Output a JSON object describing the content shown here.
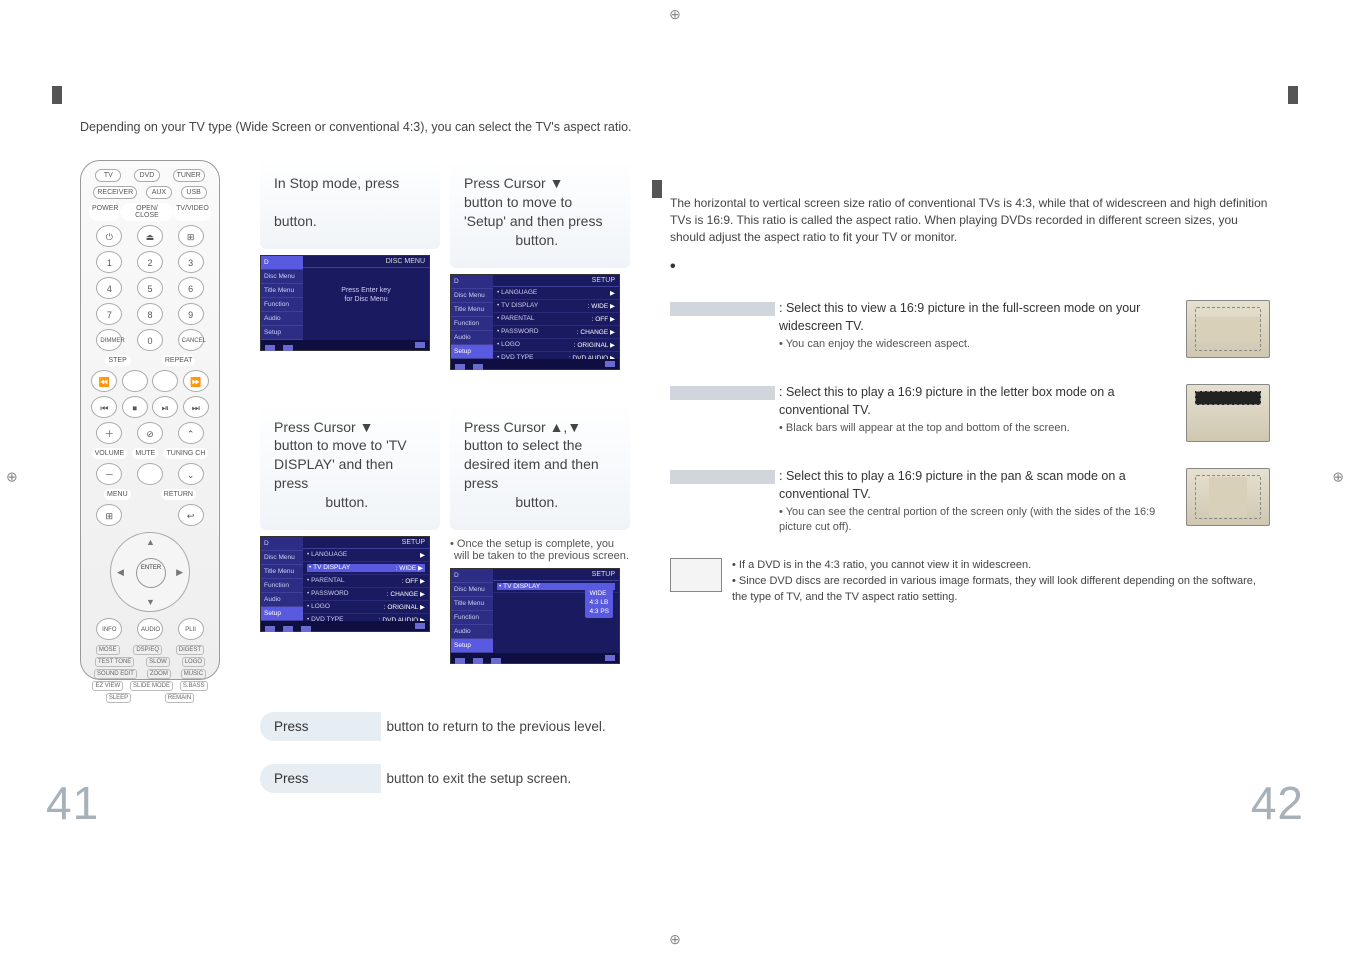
{
  "intro": "Depending on your TV type (Wide Screen  or conventional 4:3), you can select the TV's aspect ratio.",
  "remote": {
    "row1": [
      "TV",
      "DVD",
      "TUNER"
    ],
    "row2": [
      "RECEIVER",
      "AUX",
      "USB"
    ],
    "row3_labels": [
      "POWER",
      "OPEN/\nCLOSE",
      "TV/VIDEO"
    ],
    "digits": [
      "1",
      "2",
      "3",
      "4",
      "5",
      "6",
      "7",
      "8",
      "9",
      "0"
    ],
    "dimmer": "DIMMER",
    "cancel": "CANCEL",
    "step": "STEP",
    "repeat": "REPEAT",
    "mute": "MUTE",
    "volume": "VOLUME",
    "tuning": "TUNING CH",
    "menu": "MENU",
    "return": "RETURN",
    "enter": "ENTER",
    "info": "INFO",
    "audio": "AUDIO",
    "labels": [
      "MOSE",
      "DSP/EQ",
      "DIGEST",
      "TEST TONE",
      "SLOW",
      "LOGO",
      "SOUND EDIT",
      "ZOOM",
      "MUSIC",
      "EZ VIEW",
      "SLIDE MODE",
      "S.BASS",
      "SLEEP",
      "REMAIN"
    ]
  },
  "steps": {
    "s1": {
      "text_pre": "In Stop mode, press",
      "text_post": "button."
    },
    "s2": {
      "text_pre": "Press Cursor",
      "text_mid": "button to move to 'Setup' and then press",
      "text_post": "button."
    },
    "s3": {
      "text_pre": "Press Cursor",
      "text_mid": "button to move to 'TV DISPLAY' and then press",
      "text_post": "button."
    },
    "s4": {
      "text_pre": "Press Cursor",
      "text_mid": "button to select the desired item and then press",
      "text_post": "button."
    },
    "setup_note": "• Once the setup is complete, you will be taken to the previous screen."
  },
  "osd": {
    "side": [
      "Disc Menu",
      "Title Menu",
      "Function",
      "Audio",
      "Setup"
    ],
    "side_alt_top": "D",
    "menu_title": "DISC MENU",
    "setup_title": "SETUP",
    "disc_msg_line1": "Press Enter key",
    "disc_msg_line2": "for Disc Menu",
    "lines": [
      {
        "k": "LANGUAGE",
        "v": ""
      },
      {
        "k": "TV  DISPLAY",
        "v": "WIDE"
      },
      {
        "k": "PARENTAL",
        "v": "OFF"
      },
      {
        "k": "PASSWORD",
        "v": "CHANGE"
      },
      {
        "k": "LOGO",
        "v": "ORIGINAL"
      },
      {
        "k": "DVD TYPE",
        "v": "DVD AUDIO"
      }
    ],
    "tv_opts": [
      "WIDE",
      "4:3 LB",
      "4:3 PS"
    ]
  },
  "right": {
    "intro": "The horizontal to vertical screen size ratio of conventional TVs is 4:3, while that of widescreen and high definition TVs is 16:9. This ratio is called the aspect ratio. When playing DVDs recorded in different screen sizes, you should adjust the aspect ratio to fit your TV or monitor.",
    "dot": "•",
    "opts": [
      {
        "main": ": Select this to view a 16:9 picture in the full-screen mode on your widescreen TV.",
        "sub": "• You can enjoy the widescreen aspect."
      },
      {
        "main": ": Select this to play a 16:9 picture in the letter box mode on a conventional TV.",
        "sub": "• Black bars will appear at the top and bottom of the screen."
      },
      {
        "main": ": Select this to play a 16:9 picture in the pan & scan mode on a conventional TV.",
        "sub": "• You can see the central portion of the screen only (with the sides of the 16:9 picture cut off)."
      }
    ],
    "note": [
      "• If a DVD is in the 4:3 ratio, you cannot view it in widescreen.",
      "• Since DVD discs are recorded in various image formats, they will look different depending on the software, the type of TV, and the TV aspect ratio setting."
    ]
  },
  "actions": {
    "press": "Press",
    "return_rest": "button to return to the previous level.",
    "exit_rest": "button to exit the setup screen."
  },
  "page_left": "41",
  "page_right": "42",
  "glyph": {
    "down": "▼",
    "up": "▲",
    "updown": "▲,▼",
    "reg": "⊕"
  }
}
